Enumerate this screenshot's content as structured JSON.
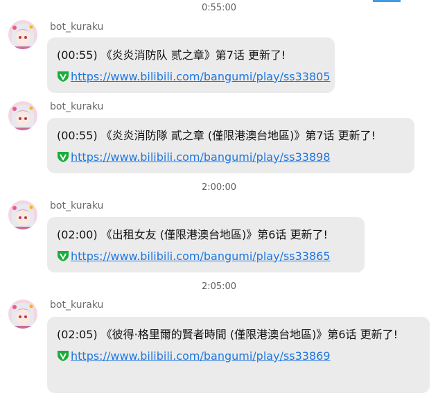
{
  "colors": {
    "bubble_bg": "#ebebeb",
    "link": "#1e76e0",
    "link_icon": "#1aad3c",
    "timestamp": "#5f5f5f",
    "sender": "#6b6b6b"
  },
  "timestamps": [
    "0:55:00",
    "2:00:00",
    "2:05:00"
  ],
  "messages": [
    {
      "sender": "bot_kuraku",
      "text": "(00:55) 《炎炎消防队 贰之章》第7话 更新了!",
      "link_icon": "v-shield-icon",
      "link": "https://www.bilibili.com/bangumi/play/ss33805"
    },
    {
      "sender": "bot_kuraku",
      "text": "(00:55) 《炎炎消防隊 貳之章 (僅限港澳台地區)》第7话 更新了!",
      "link_icon": "v-shield-icon",
      "link": "https://www.bilibili.com/bangumi/play/ss33898"
    },
    {
      "sender": "bot_kuraku",
      "text": "(02:00) 《出租女友 (僅限港澳台地區)》第6话 更新了!",
      "link_icon": "v-shield-icon",
      "link": "https://www.bilibili.com/bangumi/play/ss33865"
    },
    {
      "sender": "bot_kuraku",
      "text": "(02:05) 《彼得·格里爾的賢者時間 (僅限港澳台地區)》第6话 更新了!",
      "link_icon": "v-shield-icon",
      "link": "https://www.bilibili.com/bangumi/play/ss33869"
    }
  ]
}
